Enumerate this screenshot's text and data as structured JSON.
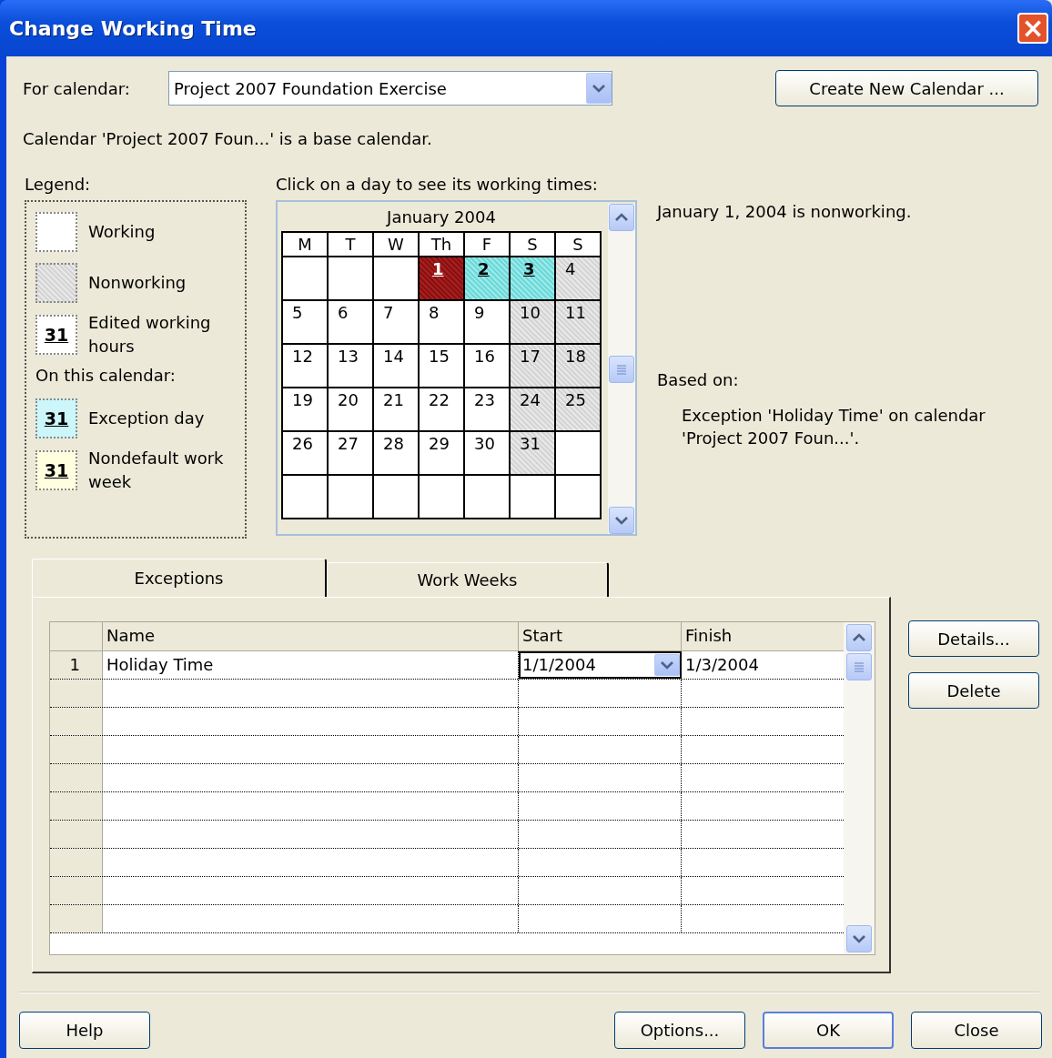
{
  "window": {
    "title": "Change Working Time",
    "close_glyph": "×"
  },
  "for_calendar": {
    "label": "For calendar:",
    "value": "Project 2007 Foundation Exercise"
  },
  "create_button": "Create New Calendar ...",
  "info": "Calendar 'Project 2007 Foun...' is a base calendar.",
  "legend": {
    "label": "Legend:",
    "sub_heading": "On this calendar:",
    "items": [
      {
        "kind": "working",
        "label": "Working"
      },
      {
        "kind": "nonworking",
        "label": "Nonworking"
      },
      {
        "kind": "edited",
        "sample": "31",
        "label": "Edited working hours"
      },
      {
        "kind": "exception",
        "sample": "31",
        "label": "Exception day"
      },
      {
        "kind": "nondefault",
        "sample": "31",
        "label": "Nondefault work week"
      }
    ]
  },
  "calendar": {
    "prompt": "Click on a day to see its working times:",
    "month": "January 2004",
    "weekdays": [
      "M",
      "T",
      "W",
      "Th",
      "F",
      "S",
      "S"
    ],
    "weeks": [
      [
        {
          "kind": "empty"
        },
        {
          "kind": "empty"
        },
        {
          "kind": "empty"
        },
        {
          "day": "1",
          "kind": "exception",
          "selected": true
        },
        {
          "day": "2",
          "kind": "exception",
          "selected": false
        },
        {
          "day": "3",
          "kind": "exception",
          "selected": false
        },
        {
          "day": "4",
          "kind": "nonworking",
          "selected": false
        }
      ],
      [
        {
          "day": "5",
          "kind": "working",
          "selected": false
        },
        {
          "day": "6",
          "kind": "working",
          "selected": false
        },
        {
          "day": "7",
          "kind": "working",
          "selected": false
        },
        {
          "day": "8",
          "kind": "working",
          "selected": false
        },
        {
          "day": "9",
          "kind": "working",
          "selected": false
        },
        {
          "day": "10",
          "kind": "nonworking",
          "selected": false
        },
        {
          "day": "11",
          "kind": "nonworking",
          "selected": false
        }
      ],
      [
        {
          "day": "12",
          "kind": "working",
          "selected": false
        },
        {
          "day": "13",
          "kind": "working",
          "selected": false
        },
        {
          "day": "14",
          "kind": "working",
          "selected": false
        },
        {
          "day": "15",
          "kind": "working",
          "selected": false
        },
        {
          "day": "16",
          "kind": "working",
          "selected": false
        },
        {
          "day": "17",
          "kind": "nonworking",
          "selected": false
        },
        {
          "day": "18",
          "kind": "nonworking",
          "selected": false
        }
      ],
      [
        {
          "day": "19",
          "kind": "working",
          "selected": false
        },
        {
          "day": "20",
          "kind": "working",
          "selected": false
        },
        {
          "day": "21",
          "kind": "working",
          "selected": false
        },
        {
          "day": "22",
          "kind": "working",
          "selected": false
        },
        {
          "day": "23",
          "kind": "working",
          "selected": false
        },
        {
          "day": "24",
          "kind": "nonworking",
          "selected": false
        },
        {
          "day": "25",
          "kind": "nonworking",
          "selected": false
        }
      ],
      [
        {
          "day": "26",
          "kind": "working",
          "selected": false
        },
        {
          "day": "27",
          "kind": "working",
          "selected": false
        },
        {
          "day": "28",
          "kind": "working",
          "selected": false
        },
        {
          "day": "29",
          "kind": "working",
          "selected": false
        },
        {
          "day": "30",
          "kind": "working",
          "selected": false
        },
        {
          "day": "31",
          "kind": "nonworking",
          "selected": false
        },
        {
          "kind": "empty"
        }
      ],
      [
        {
          "kind": "empty"
        },
        {
          "kind": "empty"
        },
        {
          "kind": "empty"
        },
        {
          "kind": "empty"
        },
        {
          "kind": "empty"
        },
        {
          "kind": "empty"
        },
        {
          "kind": "empty"
        }
      ]
    ]
  },
  "day_status": "January 1, 2004 is nonworking.",
  "based_on": {
    "label": "Based on:",
    "text": "Exception 'Holiday Time' on calendar 'Project 2007 Foun...'."
  },
  "tabs": [
    {
      "label": "Exceptions",
      "selected": true
    },
    {
      "label": "Work Weeks",
      "selected": false
    }
  ],
  "table": {
    "columns": [
      "Name",
      "Start",
      "Finish"
    ],
    "rows": [
      {
        "number": "1",
        "name": "Holiday Time",
        "start": "1/1/2004",
        "finish": "1/3/2004",
        "start_editing": true
      }
    ]
  },
  "side_buttons": [
    "Details...",
    "Delete"
  ],
  "buttons": {
    "help": "Help",
    "actions": [
      {
        "label": "Options...",
        "default": false
      },
      {
        "label": "OK",
        "default": true
      },
      {
        "label": "Close",
        "default": false
      }
    ]
  }
}
